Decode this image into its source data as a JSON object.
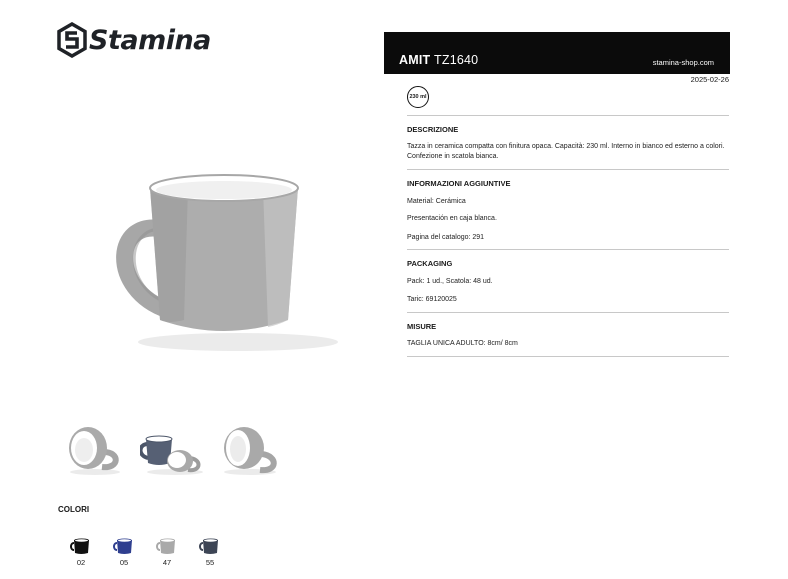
{
  "brand": {
    "logo_text": "Stamina"
  },
  "product": {
    "name": "AMIT",
    "code": "TZ1640",
    "website": "stamina-shop.com",
    "date": "2025-02-26",
    "capacity_badge": "230 ml"
  },
  "images": {
    "main_alt": "grey ceramic mug",
    "thumbnails": [
      "mug-view-1",
      "mug-view-2",
      "mug-view-3"
    ]
  },
  "colors": {
    "title": "COLORI",
    "items": [
      {
        "code": "02",
        "hex": "#111111"
      },
      {
        "code": "05",
        "hex": "#2f3f8f"
      },
      {
        "code": "47",
        "hex": "#a9a9a9"
      },
      {
        "code": "55",
        "hex": "#3d4555"
      }
    ]
  },
  "sections": {
    "descrizione": {
      "title": "DESCRIZIONE",
      "text": "Tazza in ceramica compatta con finitura opaca. Capacità: 230 ml. Interno in bianco ed esterno a colori. Confezione in scatola bianca."
    },
    "informazioni": {
      "title": "INFORMAZIONI AGGIUNTIVE",
      "lines": [
        "Material: Cerámica",
        "Presentación en caja blanca.",
        "Pagina del catalogo: 291"
      ]
    },
    "packaging": {
      "title": "PACKAGING",
      "lines": [
        "Pack: 1 ud., Scatola: 48 ud.",
        "Taric: 69120025"
      ]
    },
    "misure": {
      "title": "MISURE",
      "lines": [
        "TAGLIA UNICA ADULTO: 8cm/ 8cm"
      ]
    }
  }
}
